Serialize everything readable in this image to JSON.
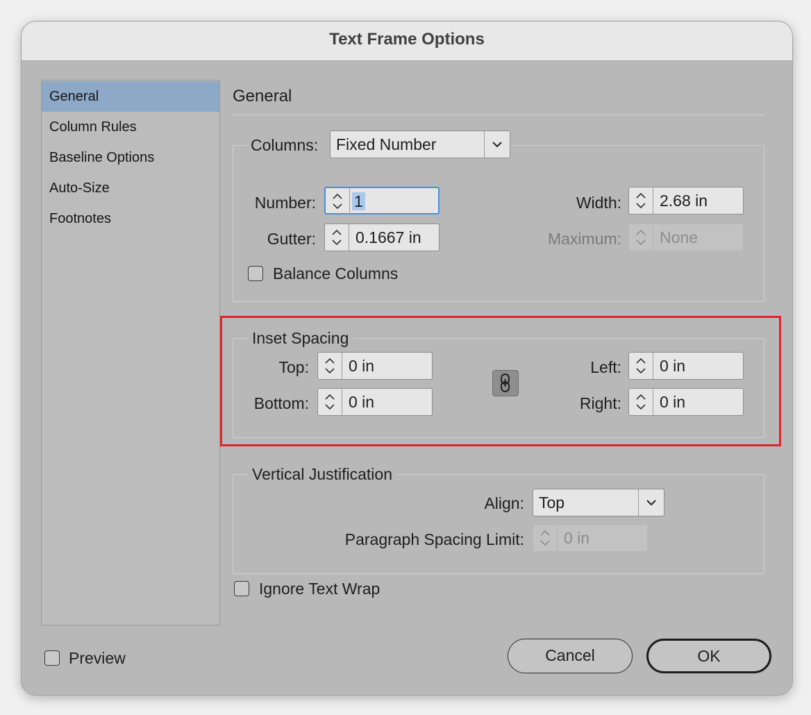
{
  "window": {
    "title": "Text Frame Options"
  },
  "sidebar": {
    "items": [
      {
        "label": "General",
        "selected": true
      },
      {
        "label": "Column Rules"
      },
      {
        "label": "Baseline Options"
      },
      {
        "label": "Auto-Size"
      },
      {
        "label": "Footnotes"
      }
    ]
  },
  "main": {
    "heading": "General"
  },
  "columns": {
    "legend_label": "Columns:",
    "type_value": "Fixed Number",
    "number_label": "Number:",
    "number_value": "1",
    "gutter_label": "Gutter:",
    "gutter_value": "0.1667 in",
    "width_label": "Width:",
    "width_value": "2.68 in",
    "maximum_label": "Maximum:",
    "maximum_value": "None",
    "balance_label": "Balance Columns",
    "balance_checked": false
  },
  "inset": {
    "legend": "Inset Spacing",
    "top_label": "Top:",
    "top_value": "0 in",
    "bottom_label": "Bottom:",
    "bottom_value": "0 in",
    "left_label": "Left:",
    "left_value": "0 in",
    "right_label": "Right:",
    "right_value": "0 in",
    "link_icon": "chain-link-icon"
  },
  "vertical": {
    "legend": "Vertical Justification",
    "align_label": "Align:",
    "align_value": "Top",
    "psl_label": "Paragraph Spacing Limit:",
    "psl_value": "0 in"
  },
  "ignore_wrap": {
    "label": "Ignore Text Wrap",
    "checked": false
  },
  "preview": {
    "label": "Preview",
    "checked": false
  },
  "buttons": {
    "cancel": "Cancel",
    "ok": "OK"
  },
  "colors": {
    "highlight": "#e0242f",
    "selection": "#8ea9c7",
    "focus": "#4a8fe0"
  }
}
